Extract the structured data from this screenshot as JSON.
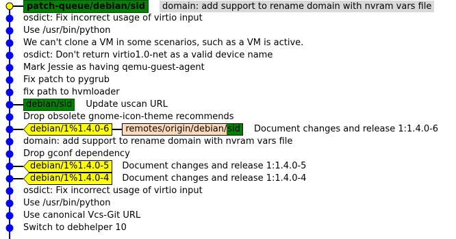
{
  "colors": {
    "graph_line": "#0000ff",
    "commit_dot": "#0000ff",
    "head_dot": "#ffff00",
    "head_ref_bg": "#008000",
    "tag_bg": "#ffff00",
    "remote_bg": "#ffdab9",
    "head_subject_bg": "#d9d9d9"
  },
  "head": {
    "ref": "patch-queue/debian/sid",
    "subject": "domain: add support to rename domain with nvram vars file"
  },
  "commits": [
    {
      "subject": "osdict: Fix incorrect usage of virtio input"
    },
    {
      "subject": "Use /usr/bin/python"
    },
    {
      "subject": "We can't clone a VM in some scenarios, such as a VM is active."
    },
    {
      "subject": "osdict: Don't return virtio1.0-net as a valid device name"
    },
    {
      "subject": "Mark Jessie as having qemu-guest-agent"
    },
    {
      "subject": "Fix patch to pygrub"
    },
    {
      "subject": "fix path to hvmloader"
    },
    {
      "branch": "debian/sid",
      "subject": "Update uscan URL"
    },
    {
      "subject": "Drop obsolete gnome-icon-theme recommends"
    },
    {
      "tag": "debian/1%1.4.0-6",
      "remote_a": "remotes/origin/debian/",
      "remote_b": "sid",
      "subject": "Document changes and release 1:1.4.0-6"
    },
    {
      "subject": "domain: add support to rename domain with nvram vars file"
    },
    {
      "subject": "Drop gconf dependency"
    },
    {
      "tag": "debian/1%1.4.0-5",
      "subject": "Document changes and release 1:1.4.0-5"
    },
    {
      "tag": "debian/1%1.4.0-4",
      "subject": "Document changes and release 1:1.4.0-4"
    },
    {
      "subject": "osdict: Fix incorrect usage of virtio input"
    },
    {
      "subject": "Use /usr/bin/python"
    },
    {
      "subject": "Use canonical Vcs-Git URL"
    },
    {
      "subject": "Switch to debhelper 10"
    }
  ]
}
